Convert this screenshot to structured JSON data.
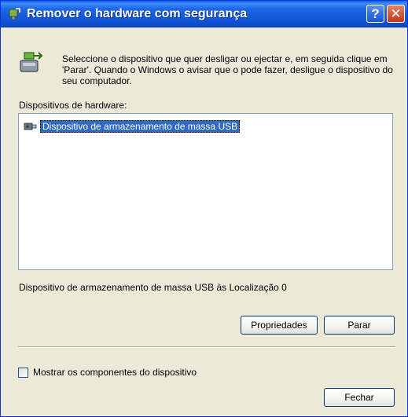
{
  "window": {
    "title": "Remover o hardware com segurança",
    "help_glyph": "?",
    "close_glyph": "✕"
  },
  "description": "Seleccione o dispositivo que quer desligar ou ejectar e, em seguida clique em 'Parar'. Quando o Windows o avisar que o pode fazer, desligue o dispositivo do seu computador.",
  "devices_label": "Dispositivos de hardware:",
  "devices": [
    {
      "name": "Dispositivo de armazenamento de massa USB",
      "icon": "usb-device-icon",
      "selected": true
    }
  ],
  "location_text": "Dispositivo de armazenamento de massa USB às Localização 0",
  "buttons": {
    "properties": "Propriedades",
    "stop": "Parar",
    "close": "Fechar"
  },
  "checkbox": {
    "label": "Mostrar os componentes do dispositivo",
    "checked": false
  },
  "colors": {
    "titlebar": "#0F56D8",
    "window_bg": "#ECE9D8",
    "selection": "#316AC5"
  }
}
